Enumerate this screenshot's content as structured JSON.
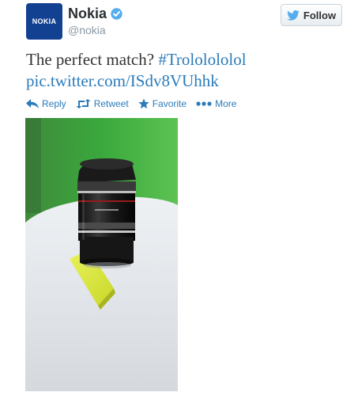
{
  "account": {
    "display_name": "Nokia",
    "username": "@nokia",
    "avatar_text": "NOKIA",
    "verified": true
  },
  "follow_button": {
    "label": "Follow"
  },
  "tweet": {
    "text_prefix": "The perfect match? ",
    "hashtag": "#Trololololol",
    "link": "pic.twitter.com/ISdv8VUhhk"
  },
  "actions": {
    "reply": "Reply",
    "retweet": "Retweet",
    "favorite": "Favorite",
    "more": "More"
  },
  "colors": {
    "link": "#2b7bb9",
    "brand": "#124191",
    "verified": "#55acee"
  },
  "icons": {
    "follow": "twitter-bird-icon",
    "reply": "reply-arrow-icon",
    "retweet": "retweet-icon",
    "favorite": "star-icon",
    "more": "more-dots-icon"
  }
}
